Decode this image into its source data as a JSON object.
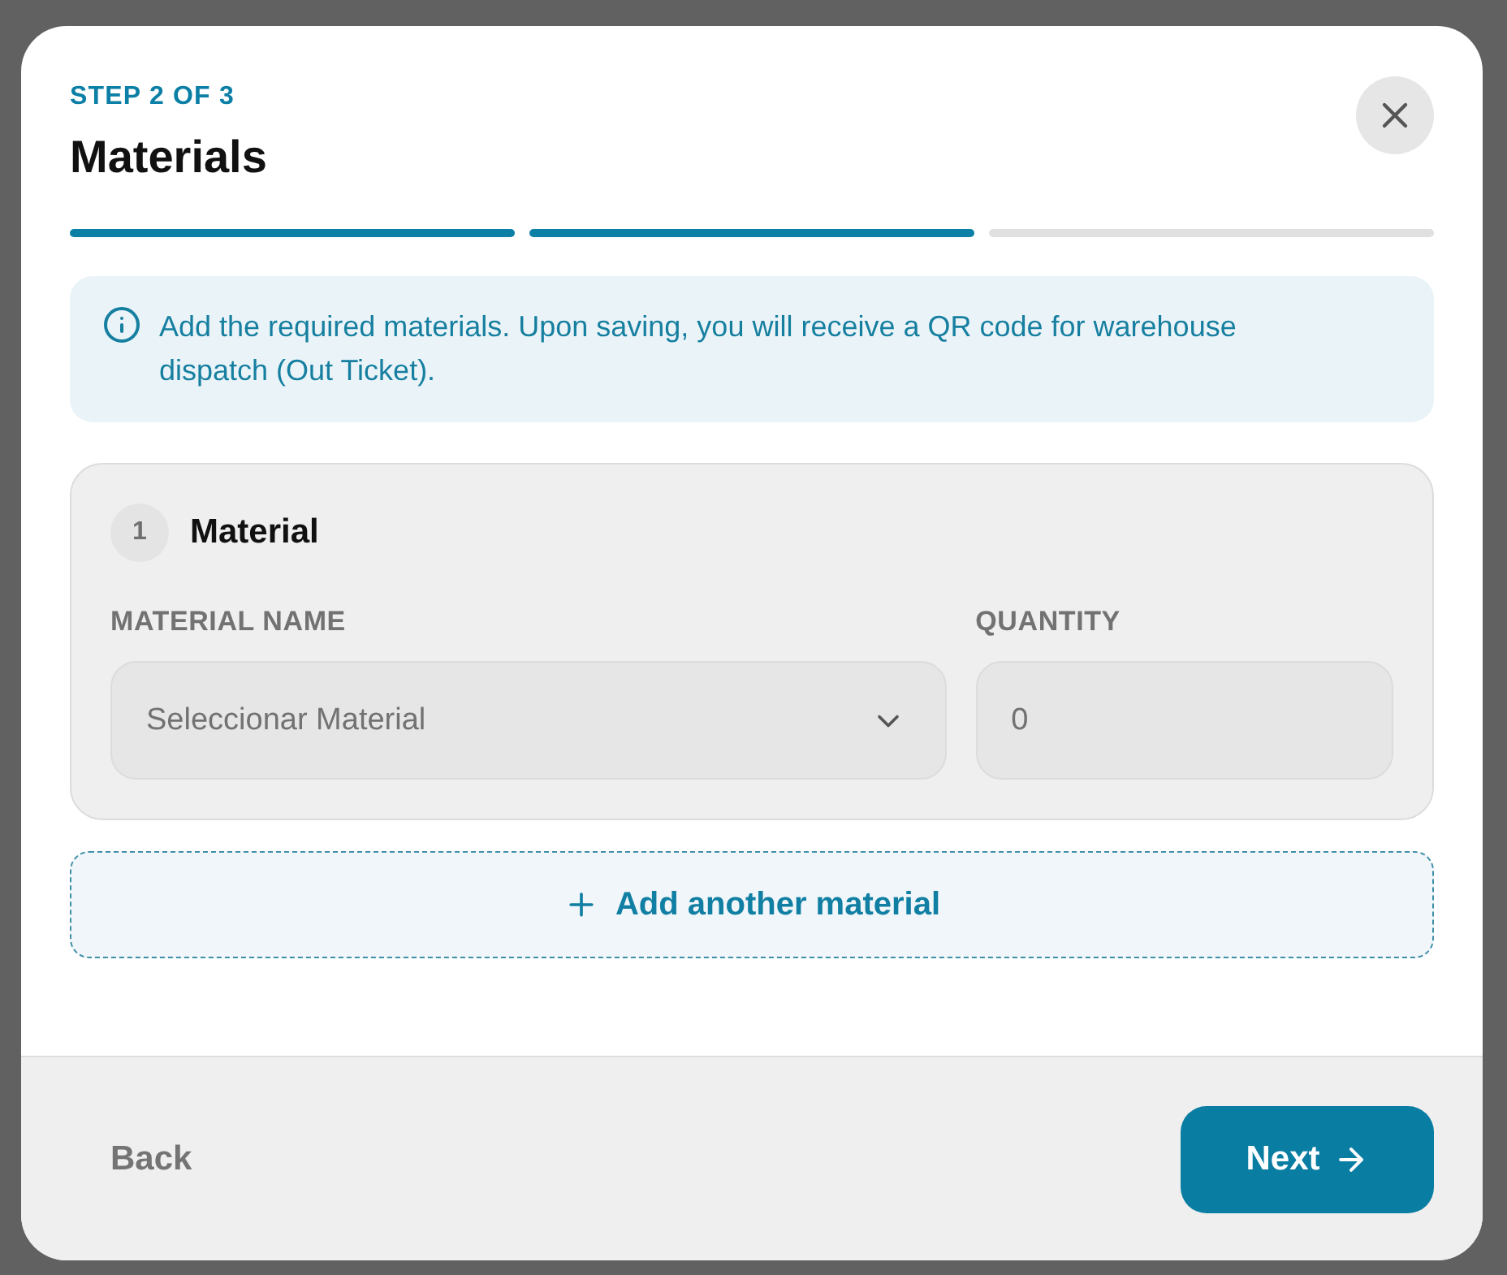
{
  "dialog": {
    "step_label": "STEP 2 OF 3",
    "title": "Materials",
    "progress": [
      {
        "done": true
      },
      {
        "done": true
      },
      {
        "done": false
      }
    ]
  },
  "notice": {
    "text": "Add the required materials. Upon saving, you will receive a QR code for warehouse dispatch (Out Ticket)."
  },
  "materials": [
    {
      "number": "1",
      "title": "Material",
      "fields": [
        {
          "kind": "select",
          "label": "MATERIAL NAME",
          "placeholder": "Seleccionar Material"
        },
        {
          "kind": "number",
          "label": "QUANTITY",
          "placeholder": "0"
        }
      ]
    }
  ],
  "add_button": {
    "label": "Add another material"
  },
  "footer": {
    "back": "Back",
    "next": "Next"
  }
}
